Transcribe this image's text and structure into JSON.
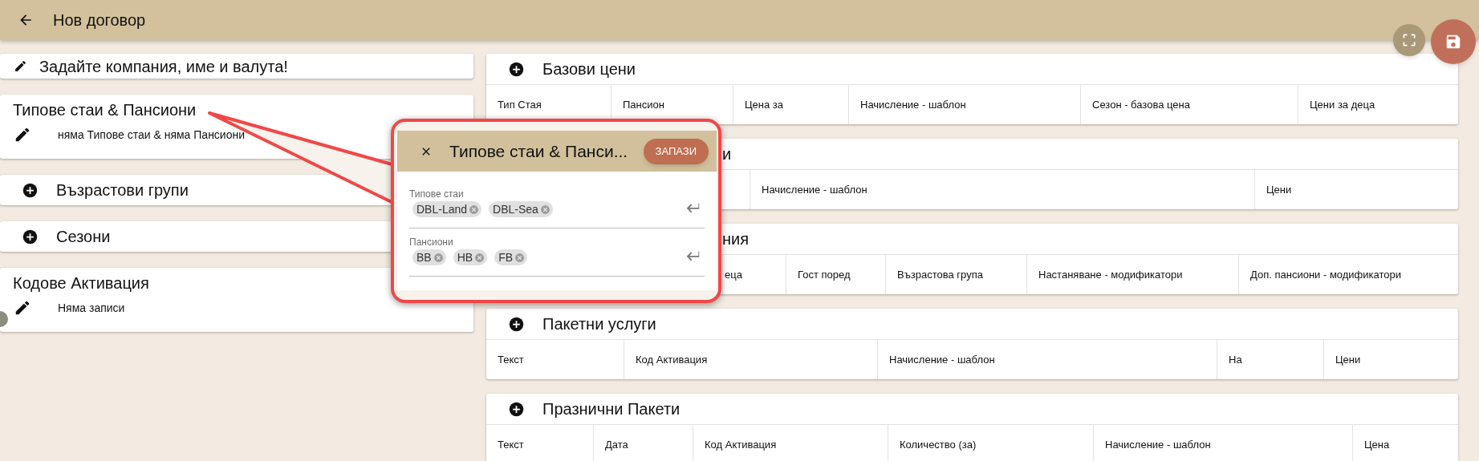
{
  "app_bar": {
    "title": "Нов договор"
  },
  "left_sections": [
    {
      "kind": "note",
      "title": "Задайте компания, име и валута!"
    },
    {
      "kind": "list",
      "title": "Типове стаи & Пансиони",
      "rows": [
        "няма Типове стаи & няма Пансиони"
      ]
    },
    {
      "kind": "add",
      "title": "Възрастови групи"
    },
    {
      "kind": "add",
      "title": "Сезони"
    },
    {
      "kind": "list",
      "title": "Кодове Активация",
      "rows": [
        "Няма записи"
      ]
    }
  ],
  "tables": [
    {
      "title": "Базови цени",
      "columns": [
        "Тип Стая",
        "Пансион",
        "Цена за",
        "Начисление - шаблон",
        "Сезон - базова цена",
        "Цени за деца"
      ]
    },
    {
      "title": "и",
      "columns": [
        "Начисление - шаблон",
        "Цени"
      ]
    },
    {
      "title": "ния",
      "columns": [
        "еца",
        "Гост поред",
        "Възрастова група",
        "Настаняване - модификатори",
        "Доп. пансиони - модификатори"
      ]
    },
    {
      "title": "Пакетни услуги",
      "columns": [
        "Текст",
        "Код Активация",
        "Начисление - шаблон",
        "На",
        "Цени"
      ]
    },
    {
      "title": "Празнични Пакети",
      "columns": [
        "Текст",
        "Дата",
        "Код Активация",
        "Количество (за)",
        "Начисление - шаблон",
        "Цена"
      ]
    }
  ],
  "dialog": {
    "title": "Типове стаи & Панси...",
    "save_label": "ЗАПАЗИ",
    "fields": [
      {
        "label": "Типове стаи",
        "chips": [
          "DBL-Land",
          "DBL-Sea"
        ]
      },
      {
        "label": "Пансиони",
        "chips": [
          "BB",
          "HB",
          "FB"
        ]
      }
    ]
  }
}
